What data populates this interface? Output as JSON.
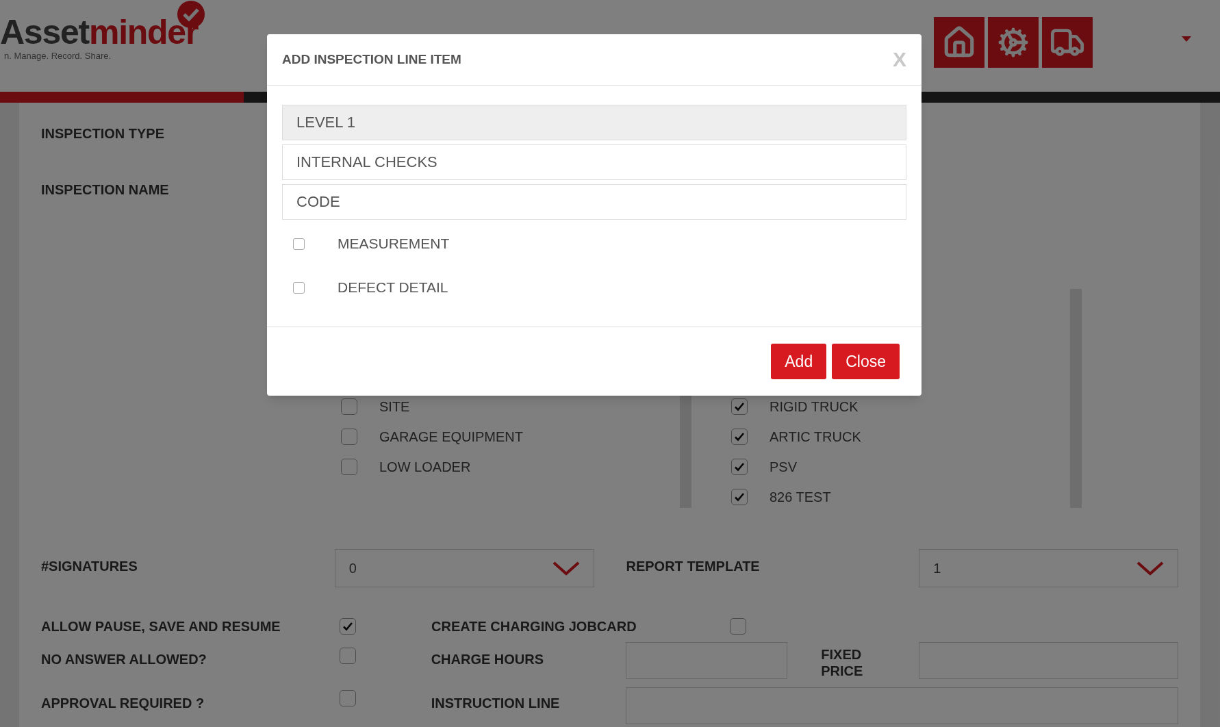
{
  "header": {
    "logo": {
      "dark_text": "Asset",
      "accent_text": "minder",
      "tagline": "n. Manage. Record. Share."
    }
  },
  "form": {
    "inspection_type_label": "INSPECTION TYPE",
    "inspection_name_label": "INSPECTION NAME",
    "asset_lists": [
      {
        "items": [
          {
            "label": "SITE",
            "checked": false
          },
          {
            "label": "GARAGE EQUIPMENT",
            "checked": false
          },
          {
            "label": "LOW LOADER",
            "checked": false
          }
        ]
      },
      {
        "items": [
          {
            "label": "RIGID TRUCK",
            "checked": true
          },
          {
            "label": "ARTIC TRUCK",
            "checked": true
          },
          {
            "label": "PSV",
            "checked": true
          },
          {
            "label": "826 TEST",
            "checked": true
          }
        ]
      }
    ],
    "signatures": {
      "label": "#SIGNATURES",
      "value": "0"
    },
    "report_template": {
      "label": "REPORT TEMPLATE",
      "value": "1"
    },
    "allow_pause": {
      "label": "ALLOW PAUSE, SAVE AND RESUME",
      "checked": true
    },
    "create_charging_jobcard": {
      "label": "CREATE CHARGING JOBCARD",
      "checked": false
    },
    "no_answer_allowed": {
      "label": "NO ANSWER ALLOWED?",
      "checked": false
    },
    "charge_hours": {
      "label": "CHARGE HOURS"
    },
    "fixed_price": {
      "label": "FIXED PRICE"
    },
    "approval_required": {
      "label": "APPROVAL REQUIRED ?",
      "checked": false
    },
    "instruction_line": {
      "label": "INSTRUCTION LINE"
    }
  },
  "modal": {
    "title": "ADD INSPECTION LINE ITEM",
    "close_glyph": "X",
    "fields": [
      {
        "value": "LEVEL 1",
        "disabled": true
      },
      {
        "value": "INTERNAL CHECKS",
        "disabled": false
      },
      {
        "placeholder": "CODE",
        "disabled": false
      }
    ],
    "checkboxes": [
      {
        "label": "MEASUREMENT",
        "checked": false
      },
      {
        "label": "DEFECT DETAIL",
        "checked": false
      }
    ],
    "buttons": [
      "Add",
      "Close"
    ]
  }
}
